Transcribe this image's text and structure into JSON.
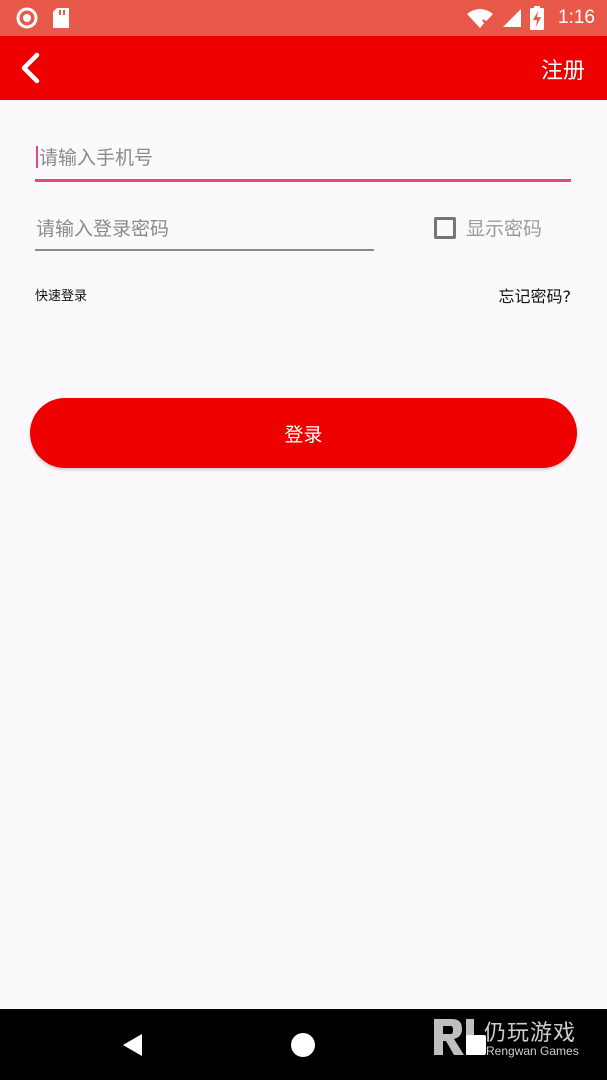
{
  "status_bar": {
    "time": "1:16",
    "icons": [
      "record-icon",
      "sd-card-icon",
      "wifi-icon",
      "signal-icon",
      "battery-charging-icon"
    ]
  },
  "app_bar": {
    "back_icon": "chevron-left-icon",
    "register_label": "注册"
  },
  "form": {
    "phone_placeholder": "请输入手机号",
    "password_placeholder": "请输入登录密码",
    "show_password_label": "显示密码",
    "show_password_checked": false,
    "quick_login_label": "快速登录",
    "forgot_password_label": "忘记密码?",
    "login_button_label": "登录"
  },
  "watermark": {
    "chinese": "仍玩游戏",
    "english": "Rengwan Games"
  },
  "colors": {
    "status_bar": "#e8594a",
    "app_bar": "#ee0000",
    "accent": "#e34a7a",
    "background": "#fcf9fd"
  }
}
